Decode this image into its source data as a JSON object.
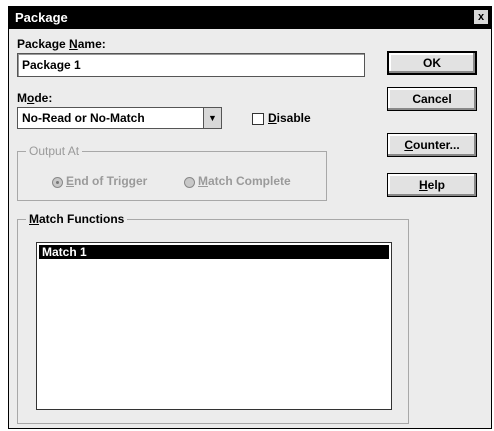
{
  "window": {
    "title": "Package",
    "close_glyph": "x"
  },
  "package_name": {
    "label_pre": "Package ",
    "label_u": "N",
    "label_post": "ame:",
    "value": "Package 1"
  },
  "mode": {
    "label_pre": "M",
    "label_u": "o",
    "label_post": "de:",
    "selected": "No-Read or No-Match",
    "arrow": "▼"
  },
  "disable": {
    "label_u": "D",
    "label_post": "isable",
    "checked": false
  },
  "output_at": {
    "label": "Output At",
    "options": [
      {
        "label_u": "E",
        "label_post": "nd of Trigger",
        "selected": true
      },
      {
        "label_u": "M",
        "label_post": "atch Complete",
        "selected": false
      }
    ]
  },
  "match_functions": {
    "label_u": "M",
    "label_post": "atch Functions",
    "items": [
      "Match 1"
    ]
  },
  "buttons": {
    "ok": "OK",
    "cancel": "Cancel",
    "counter_u": "C",
    "counter_post": "ounter...",
    "help_u": "H",
    "help_post": "elp"
  }
}
